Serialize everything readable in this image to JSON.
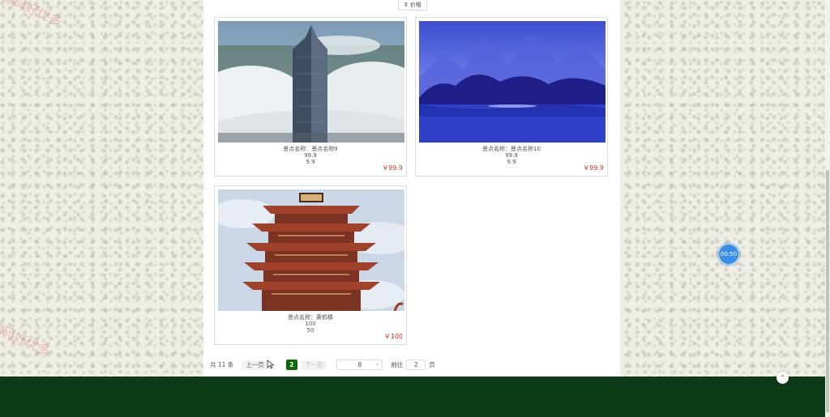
{
  "toolbar": {
    "sort_label": "价格",
    "sort_icon": "sort-icon"
  },
  "cards": [
    {
      "name": "景点名称：景点名称9",
      "line2": "99.9",
      "line3": "9.9",
      "price": "￥99.9",
      "image": "skyscraper-in-clouds"
    },
    {
      "name": "景点名称：景点名称10",
      "line2": "99.9",
      "line3": "9.9",
      "price": "￥99.9",
      "image": "blue-karst-river"
    },
    {
      "name": "景点名称：黄鹤楼",
      "line2": "100",
      "line3": "50",
      "price": "￥100",
      "image": "yellow-crane-tower"
    }
  ],
  "pagination": {
    "total": "共 11 条",
    "prev": "上一页",
    "current": "2",
    "next": "下一页",
    "page_size": "8",
    "goto_label": "前往",
    "goto_value": "2",
    "goto_suffix": "页"
  },
  "watermark": "源码好优多",
  "timer": "00:50",
  "back_to_top": "⌃",
  "colors": {
    "accent_green": "#0c6a0c",
    "footer_green": "#0c3c16",
    "price_red": "#d0342c",
    "timer_blue": "#3a8ee6"
  }
}
